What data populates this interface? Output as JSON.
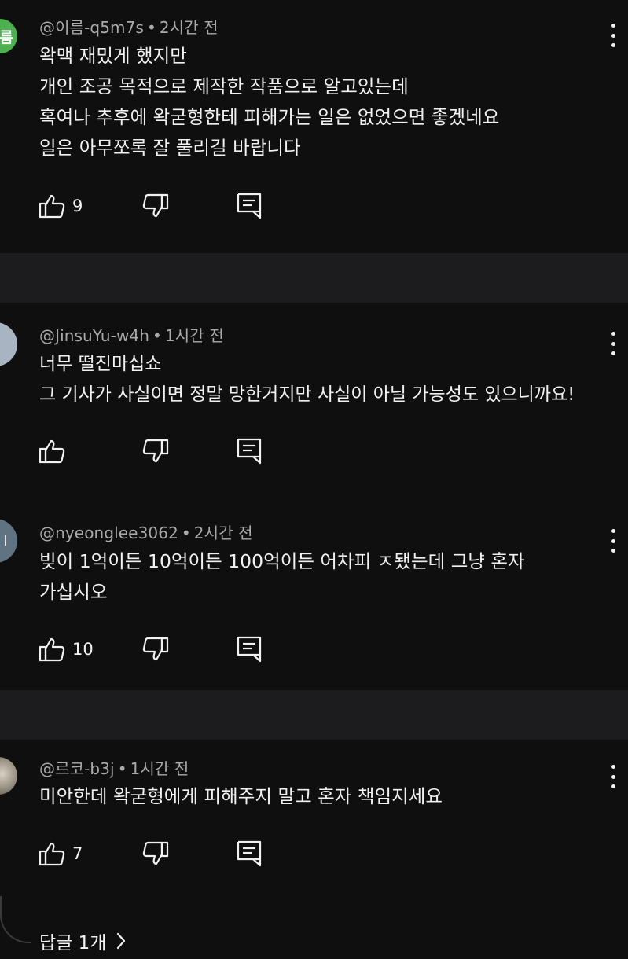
{
  "comments": [
    {
      "author": "@이름-q5m7s",
      "time": "2시간 전",
      "avatar_text": "름",
      "avatar_color": "#4caf50",
      "text": "왁맥 재밌게 했지만\n개인 조공 목적으로 제작한 작품으로 알고있는데\n혹여나 추후에 왁굳형한테 피해가는 일은 없었으면 좋겠네요\n일은 아무쪼록 잘 풀리길 바랍니다",
      "likes": "9"
    },
    {
      "author": "@JinsuYu-w4h",
      "time": "1시간 전",
      "avatar_text": "",
      "avatar_color": "#a9b4c2",
      "text": "너무 떨진마십쇼\n그 기사가 사실이면 정말 망한거지만 사실이 아닐 가능성도 있으니까요!",
      "likes": ""
    },
    {
      "author": "@nyeonglee3062",
      "time": "2시간 전",
      "avatar_text": "l",
      "avatar_color": "#5f7382",
      "text": "빚이 1억이든 10억이든 100억이든 어차피 ㅈ됐는데 그냥 혼자\n가십시오",
      "likes": "10"
    },
    {
      "author": "@르코-b3j",
      "time": "1시간 전",
      "avatar_text": "",
      "avatar_color": "#8a8478",
      "text": "미안한데 왁굳형에게 피해주지 말고 혼자 책임지세요",
      "likes": "7",
      "replies_label": "답글 1개"
    }
  ],
  "meta_separator": "•",
  "icons": {
    "like": "thumbs-up-icon",
    "dislike": "thumbs-down-icon",
    "reply": "comment-icon",
    "more": "more-vert-icon",
    "expand": "chevron-right-icon"
  }
}
